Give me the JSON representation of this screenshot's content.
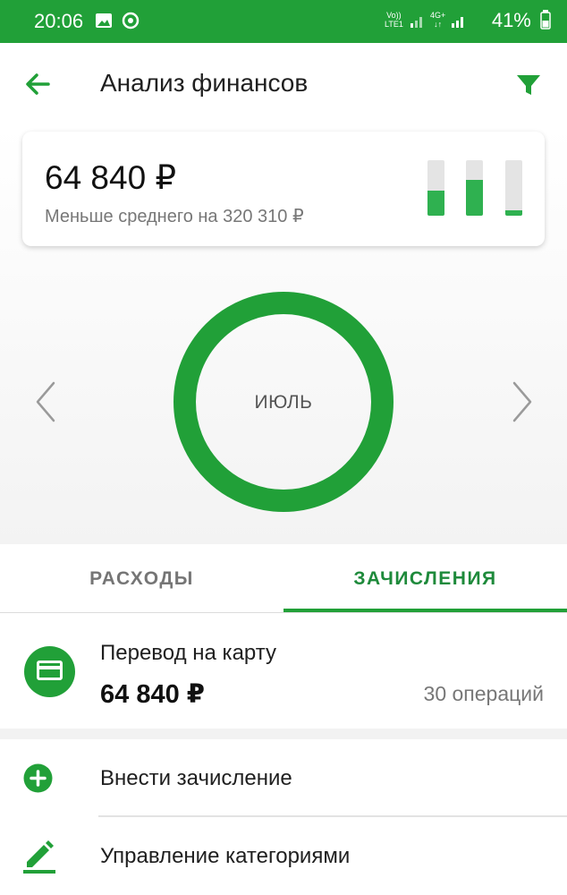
{
  "status_bar": {
    "time": "20:06",
    "network_1": "Vo))\nLTE1",
    "network_2": "4G+",
    "battery": "41%",
    "icons": [
      "image-icon",
      "chrome-icon",
      "signal-icon",
      "battery-icon"
    ]
  },
  "app_bar": {
    "title": "Анализ финансов",
    "back_icon": "arrow-left-icon",
    "filter_icon": "filter-icon"
  },
  "summary": {
    "amount": "64 840 ₽",
    "subtitle": "Меньше среднего на 320 310 ₽",
    "bars": [
      {
        "fill": 0.45
      },
      {
        "fill": 0.65
      },
      {
        "fill": 0.1
      }
    ]
  },
  "chart": {
    "center_label": "ИЮЛЬ",
    "prev_icon": "chevron-left-icon",
    "next_icon": "chevron-right-icon"
  },
  "tabs": [
    {
      "label": "РАСХОДЫ",
      "active": false
    },
    {
      "label": "ЗАЧИСЛЕНИЯ",
      "active": true
    }
  ],
  "category": {
    "label": "Перевод на карту",
    "amount": "64 840 ₽",
    "count": "30 операций",
    "icon": "credit-card-icon"
  },
  "actions": [
    {
      "label": "Внести зачисление",
      "icon": "plus-circle-icon"
    },
    {
      "label": "Управление категориями",
      "icon": "pencil-icon"
    }
  ],
  "colors": {
    "brand": "#21a038",
    "text": "#1f1f1f",
    "muted": "#777777"
  }
}
